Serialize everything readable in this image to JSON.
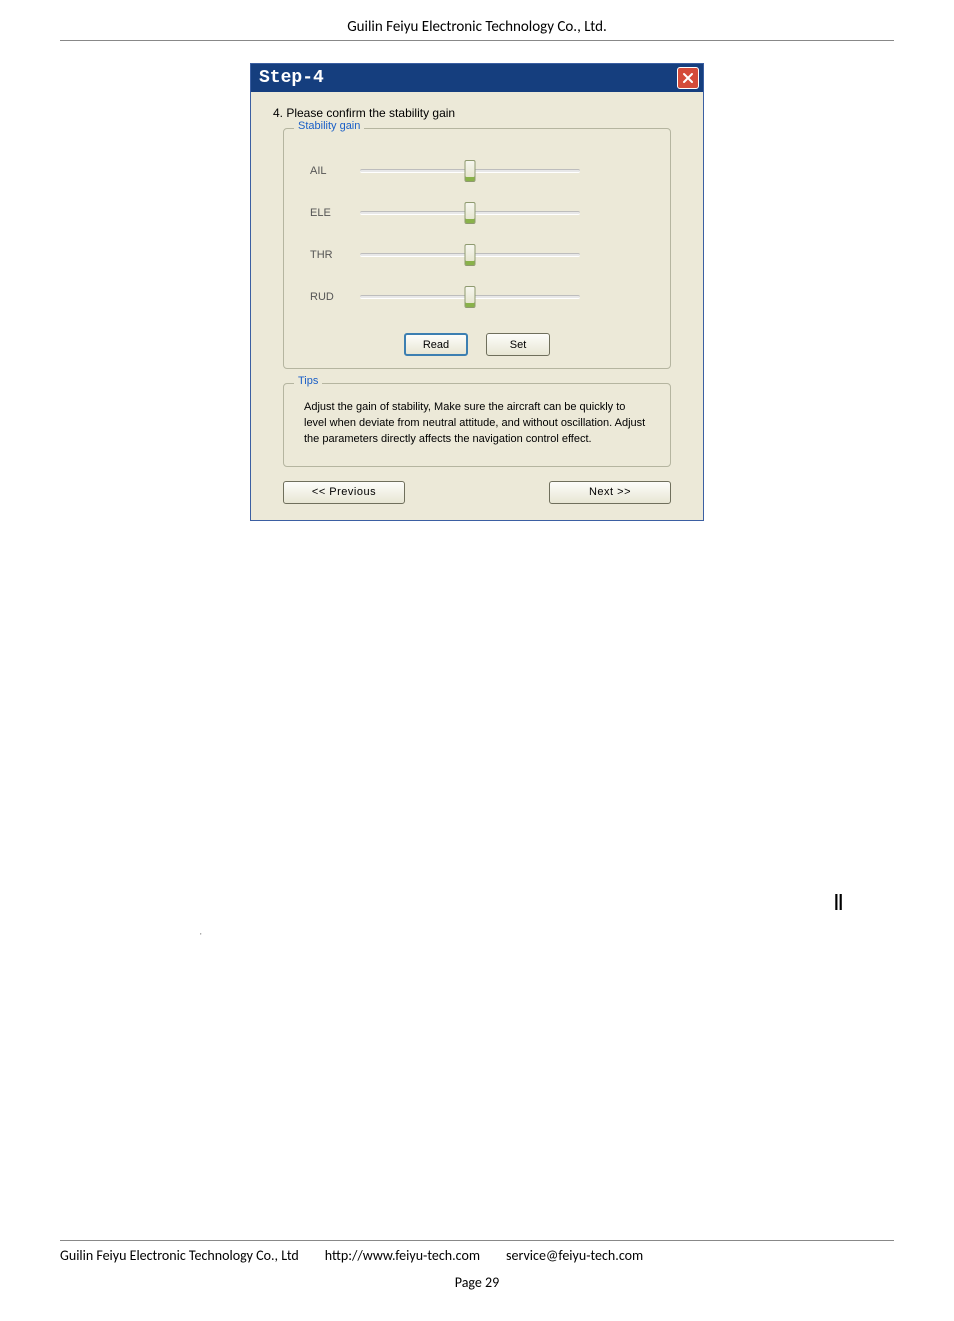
{
  "header": {
    "company": "Guilin Feiyu Electronic Technology Co., Ltd."
  },
  "dialog": {
    "title": "Step-4",
    "heading": "4. Please confirm the stability gain",
    "stability_group": {
      "legend": "Stability gain",
      "sliders": [
        {
          "label": "AIL"
        },
        {
          "label": "ELE"
        },
        {
          "label": "THR"
        },
        {
          "label": "RUD"
        }
      ],
      "read_btn": "Read",
      "set_btn": "Set"
    },
    "tips_group": {
      "legend": "Tips",
      "text": "Adjust the gain of stability, Make sure the aircraft can be quickly to level when deviate from neutral attitude, and without oscillation. Adjust the parameters directly affects the navigation control effect."
    },
    "prev_btn": "<< Previous",
    "next_btn": "Next  >>"
  },
  "glyphs": {
    "left": ",",
    "right": "Ⅱ"
  },
  "footer": {
    "company": "Guilin Feiyu Electronic Technology Co., Ltd",
    "url": "http://www.feiyu-tech.com",
    "email": "service@feiyu-tech.com",
    "page": "Page 29"
  }
}
